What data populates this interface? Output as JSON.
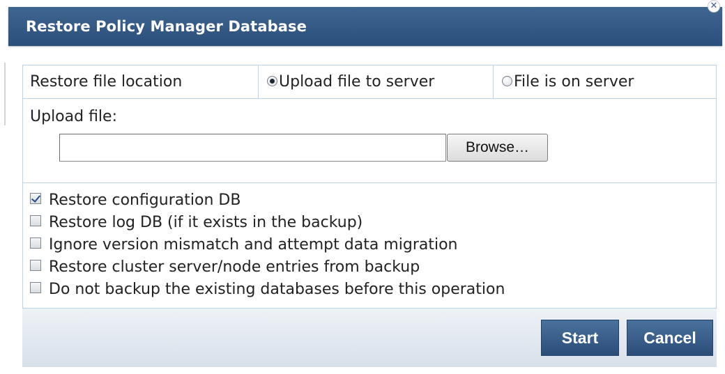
{
  "dialog": {
    "title": "Restore Policy Manager Database",
    "close_icon": "close-icon",
    "close_glyph": "✕"
  },
  "location": {
    "label": "Restore file location",
    "options": [
      {
        "label": "Upload file to server",
        "selected": true
      },
      {
        "label": "File is on server",
        "selected": false
      }
    ]
  },
  "upload": {
    "label": "Upload file:",
    "value": "",
    "browse_label": "Browse…"
  },
  "checks": [
    {
      "label": "Restore configuration DB",
      "checked": true
    },
    {
      "label": "Restore log DB (if it exists in the backup)",
      "checked": false
    },
    {
      "label": "Ignore version mismatch and attempt data migration",
      "checked": false
    },
    {
      "label": "Restore cluster server/node entries from backup",
      "checked": false
    },
    {
      "label": "Do not backup the existing databases before this operation",
      "checked": false
    }
  ],
  "footer": {
    "start_label": "Start",
    "cancel_label": "Cancel"
  },
  "colors": {
    "titlebar": "#2b4f7b",
    "button": "#2a4d78",
    "border": "#bfd3e8"
  }
}
